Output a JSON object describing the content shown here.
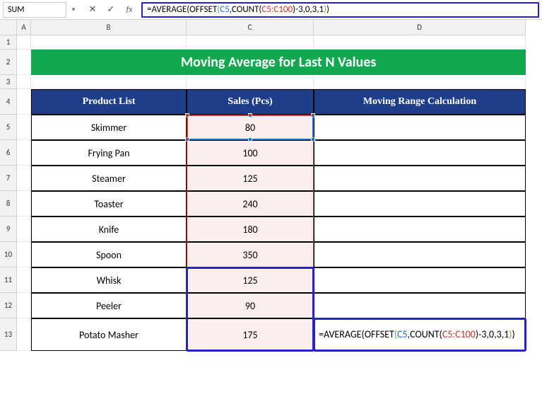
{
  "name_box": "SUM",
  "formula": "=AVERAGE(OFFSET(C5,COUNT(C5:C100)-3,0,3,1))",
  "formula_parts": {
    "p1": "=AVERAGE",
    "p2": "(",
    "p3": "OFFSET",
    "p4": "(",
    "p5": "C5",
    "p6": ",COUNT(",
    "p7": "C5:C100",
    "p8": ")-3,0,3,1",
    "p9": ")",
    "p10": ")"
  },
  "title": "Moving Average for Last N Values",
  "headers": {
    "b": "Product List",
    "c": "Sales (Pcs)",
    "d": "Moving Range Calculation"
  },
  "rows": [
    {
      "b": "Skimmer",
      "c": "80"
    },
    {
      "b": "Frying Pan",
      "c": "100"
    },
    {
      "b": "Steamer",
      "c": "125"
    },
    {
      "b": "Toaster",
      "c": "240"
    },
    {
      "b": "Knife",
      "c": "180"
    },
    {
      "b": "Spoon",
      "c": "350"
    },
    {
      "b": "Whisk",
      "c": "125"
    },
    {
      "b": "Peeler",
      "c": "90"
    },
    {
      "b": "Potato Masher",
      "c": "175"
    }
  ],
  "col_labels": {
    "A": "A",
    "B": "B",
    "C": "C",
    "D": "D"
  },
  "row_labels": [
    "1",
    "2",
    "3",
    "4",
    "5",
    "6",
    "7",
    "8",
    "9",
    "10",
    "11",
    "12",
    "13"
  ],
  "chart_data": {
    "type": "table",
    "title": "Moving Average for Last N Values",
    "columns": [
      "Product List",
      "Sales (Pcs)",
      "Moving Range Calculation"
    ],
    "rows": [
      [
        "Skimmer",
        80,
        null
      ],
      [
        "Frying Pan",
        100,
        null
      ],
      [
        "Steamer",
        125,
        null
      ],
      [
        "Toaster",
        240,
        null
      ],
      [
        "Knife",
        180,
        null
      ],
      [
        "Spoon",
        350,
        null
      ],
      [
        "Whisk",
        125,
        null
      ],
      [
        "Peeler",
        90,
        null
      ],
      [
        "Potato Masher",
        175,
        "=AVERAGE(OFFSET(C5,COUNT(C5:C100)-3,0,3,1))"
      ]
    ],
    "active_cell": "D13",
    "formula": "=AVERAGE(OFFSET(C5,COUNT(C5:C100)-3,0,3,1))"
  }
}
